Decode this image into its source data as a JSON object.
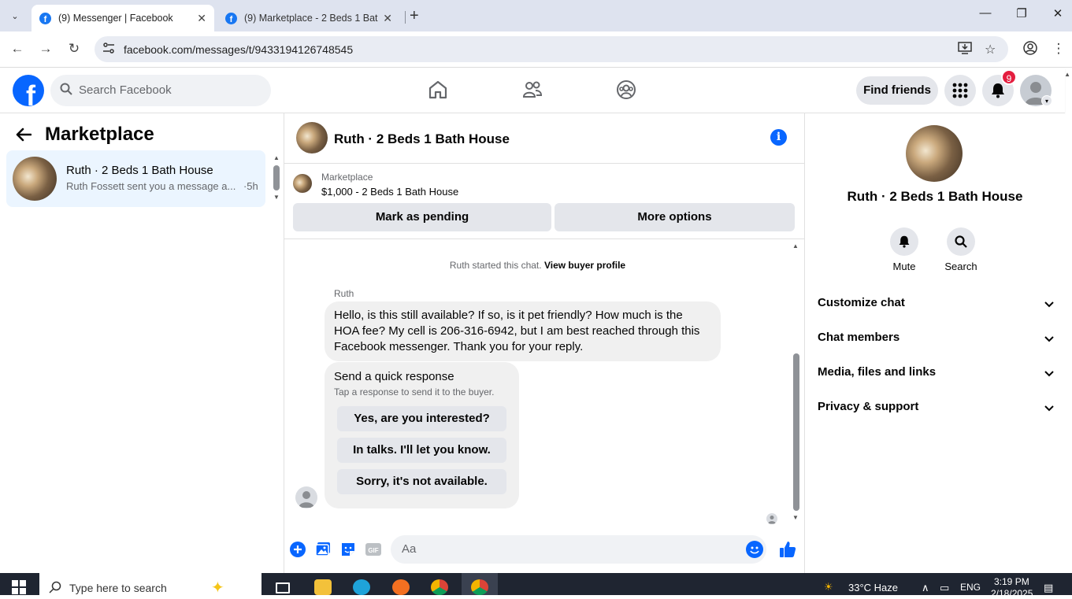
{
  "browser": {
    "tabs": [
      {
        "title": "(9) Messenger | Facebook",
        "active": true
      },
      {
        "title": "(9) Marketplace - 2 Beds 1 Bath",
        "active": false
      }
    ],
    "url": "facebook.com/messages/t/9433194126748545"
  },
  "fb_header": {
    "search_placeholder": "Search Facebook",
    "find_friends": "Find friends",
    "notification_count": "9",
    "brand_color": "#0866ff"
  },
  "left_panel": {
    "title": "Marketplace",
    "conversations": [
      {
        "name": "Ruth · 2 Beds 1 Bath House",
        "preview": "Ruth Fossett sent you a message a...",
        "time": "·5h"
      }
    ]
  },
  "chat": {
    "title": "Ruth · 2 Beds 1 Bath House",
    "listing": {
      "label": "Marketplace",
      "price_title": "$1,000 - 2 Beds 1 Bath House",
      "mark_pending": "Mark as pending",
      "more_options": "More options"
    },
    "started_text": "Ruth started this chat.",
    "view_profile": "View buyer profile",
    "sender": "Ruth",
    "message": "Hello, is this still available?  If so, is it pet friendly?  How much is the HOA fee?  My cell is 206-316-6942, but I am best reached through this Facebook messenger.  Thank you for your reply.",
    "quick_response": {
      "title": "Send a quick response",
      "subtitle": "Tap a response to send it to the buyer.",
      "options": [
        "Yes, are you interested?",
        "In talks. I'll let you know.",
        "Sorry, it's not available."
      ]
    },
    "composer_placeholder": "Aa"
  },
  "right_panel": {
    "name": "Ruth · 2 Beds 1 Bath House",
    "actions": {
      "mute": "Mute",
      "search": "Search"
    },
    "sections": [
      "Customize chat",
      "Chat members",
      "Media, files and links",
      "Privacy & support"
    ]
  },
  "taskbar": {
    "search_placeholder": "Type here to search",
    "weather": "33°C  Haze",
    "language": "ENG",
    "time": "3:19 PM",
    "date": "2/18/2025"
  }
}
